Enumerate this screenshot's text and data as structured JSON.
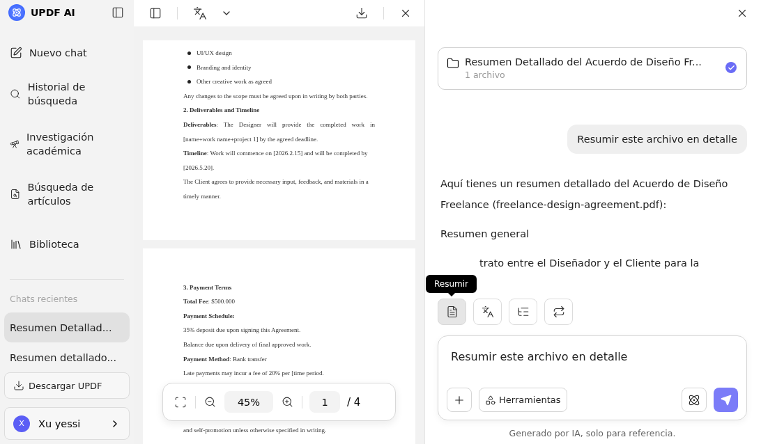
{
  "sidebar": {
    "app_name": "UPDF AI",
    "nav": [
      {
        "kind": "new-chat",
        "label": "Nuevo chat"
      },
      {
        "kind": "history",
        "label": "Historial de búsqueda"
      },
      {
        "kind": "research",
        "label": "Investigación académica"
      },
      {
        "kind": "articles",
        "label": "Búsqueda de artículos"
      },
      {
        "kind": "library",
        "label": "Biblioteca"
      }
    ],
    "recent_label": "Chats recientes",
    "recent": [
      {
        "label": "Resumen Detallad...",
        "selected": true
      },
      {
        "label": "Resumen detallado...",
        "selected": false
      }
    ],
    "download_button": "Descargar UPDF",
    "user": {
      "initial": "X",
      "name": "Xu yessi"
    }
  },
  "viewer": {
    "pages": [
      {
        "lines": [
          {
            "kind": "bullet",
            "text": "UI/UX design"
          },
          {
            "kind": "bullet",
            "text": "Branding and identity"
          },
          {
            "kind": "bullet",
            "text": "Other creative work as agreed"
          },
          {
            "kind": "para",
            "text": "Any changes to the scope must be agreed upon in writing by both parties."
          },
          {
            "kind": "heading",
            "text": "2. Deliverables and Timeline"
          },
          {
            "kind": "justified",
            "text": "**Deliverables**: The Designer will provide the completed work in"
          },
          {
            "kind": "para",
            "text": "[name+work name+project 1] by the agreed deadline."
          },
          {
            "kind": "para",
            "text": "**Timeline**: Work will commence on [2026.2.15] and will be completed by"
          },
          {
            "kind": "para",
            "text": "[2026.5.20]."
          },
          {
            "kind": "para",
            "text": "The Client agrees to provide necessary input, feedback, and materials in a"
          },
          {
            "kind": "para",
            "text": "timely manner."
          }
        ]
      },
      {
        "lines": [
          {
            "kind": "heading",
            "text": "3. Payment Terms"
          },
          {
            "kind": "para",
            "text": "**Total Fee**: $500.000"
          },
          {
            "kind": "heading",
            "text": "Payment Schedule:"
          },
          {
            "kind": "para",
            "text": "35% deposit due upon signing this Agreement."
          },
          {
            "kind": "para",
            "text": "Balance due upon delivery of final approved work."
          },
          {
            "kind": "para",
            "text": "**Payment Method**: Bank transfer"
          },
          {
            "kind": "para",
            "text": "Late payments may incur a fee of 20% per [time period."
          },
          {
            "kind": "gap"
          },
          {
            "kind": "gap"
          },
          {
            "kind": "gap"
          },
          {
            "kind": "para",
            "text": "and self-promotion unless otherwise specified in writing."
          }
        ]
      }
    ],
    "zoom": "45%",
    "page": "1",
    "page_total": "/ 4"
  },
  "chat": {
    "file": {
      "title": "Resumen Detallado del Acuerdo de Diseño Fr...",
      "count": "1 archivo",
      "selected": true
    },
    "user_message": "Resumir este archivo en detalle",
    "answer": [
      {
        "kind": "para",
        "text": "Aquí tienes un resumen detallado del Acuerdo de Diseño Freelance (freelance-design-agreement.pdf):"
      },
      {
        "kind": "para",
        "text": "Resumen general"
      },
      {
        "kind": "covered",
        "text": "trato entre el Diseñador y el Cliente para la"
      }
    ],
    "tooltip": "Resumir",
    "tools": [
      {
        "kind": "summarize",
        "selected": true
      },
      {
        "kind": "translate",
        "selected": false
      },
      {
        "kind": "outline",
        "selected": false
      },
      {
        "kind": "convert",
        "selected": false
      }
    ],
    "input": {
      "value": "Resumir este archivo en detalle"
    },
    "tools_button": "Herramientas",
    "footer": "Generado por IA, solo para referencia."
  }
}
